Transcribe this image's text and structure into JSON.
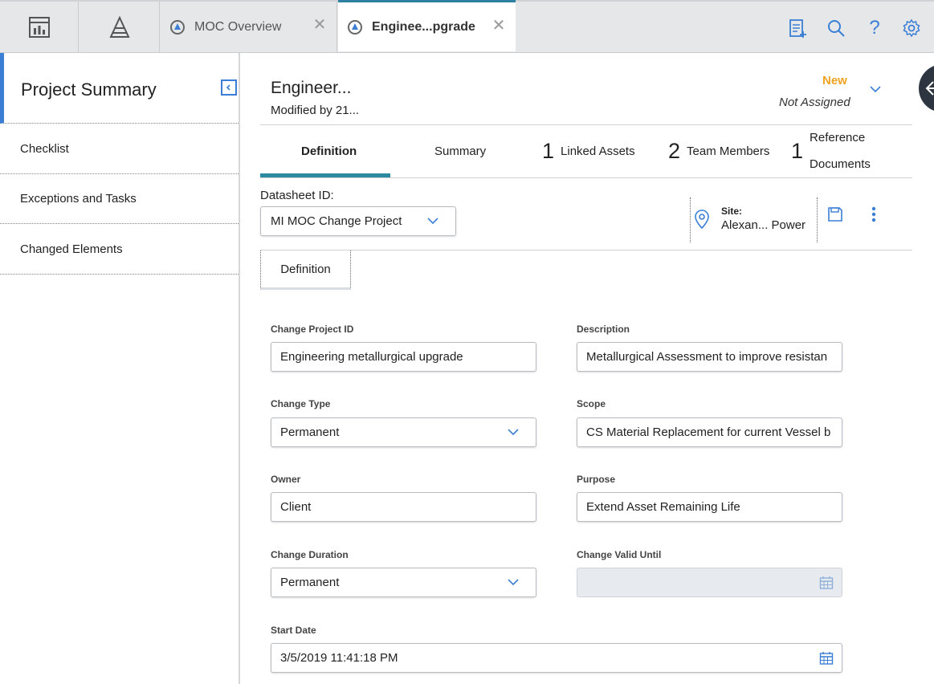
{
  "colors": {
    "accent": "#2b8aa0",
    "link_blue": "#3a7fd5",
    "state_new": "#f0a320"
  },
  "topbar": {
    "icons": [
      "dashboard-icon",
      "pyramid-icon"
    ],
    "tabs": [
      {
        "label": "MOC Overview",
        "icon": "moc-refresh-icon",
        "active": false
      },
      {
        "label": "Enginee...pgrade",
        "icon": "moc-refresh-icon",
        "active": true
      }
    ],
    "right_icons": [
      "clipboard-add-icon",
      "search-icon",
      "help-icon",
      "gear-icon"
    ]
  },
  "sidebar": {
    "title": "Project Summary",
    "items": [
      {
        "label": "Checklist"
      },
      {
        "label": "Exceptions and Tasks"
      },
      {
        "label": "Changed Elements"
      }
    ]
  },
  "record": {
    "title": "Engineer...",
    "modified": "Modified by 21...",
    "state": "New",
    "assigned": "Not Assigned"
  },
  "tabs": [
    {
      "label": "Definition",
      "count": ""
    },
    {
      "label": "Summary",
      "count": ""
    },
    {
      "label": "Linked Assets",
      "count": "1"
    },
    {
      "label": "Team Members",
      "count": "2"
    },
    {
      "label": "Reference",
      "label2": "Documents",
      "count": "1"
    }
  ],
  "datasheet": {
    "label": "Datasheet ID:",
    "value": "MI MOC Change Project",
    "site_label": "Site:",
    "site_value": "Alexan... Power"
  },
  "subtab": {
    "label": "Definition"
  },
  "form": {
    "change_project_id": {
      "label": "Change Project ID",
      "value": "Engineering metallurgical upgrade"
    },
    "description": {
      "label": "Description",
      "value": "Metallurgical Assessment to improve resistan"
    },
    "change_type": {
      "label": "Change Type",
      "value": "Permanent"
    },
    "scope": {
      "label": "Scope",
      "value": "CS Material Replacement for current Vessel b"
    },
    "owner": {
      "label": "Owner",
      "value": "Client"
    },
    "purpose": {
      "label": "Purpose",
      "value": "Extend Asset Remaining Life"
    },
    "change_duration": {
      "label": "Change Duration",
      "value": "Permanent"
    },
    "change_valid_until": {
      "label": "Change Valid Until",
      "value": ""
    },
    "start_date": {
      "label": "Start Date",
      "value": "3/5/2019 11:41:18 PM"
    }
  }
}
